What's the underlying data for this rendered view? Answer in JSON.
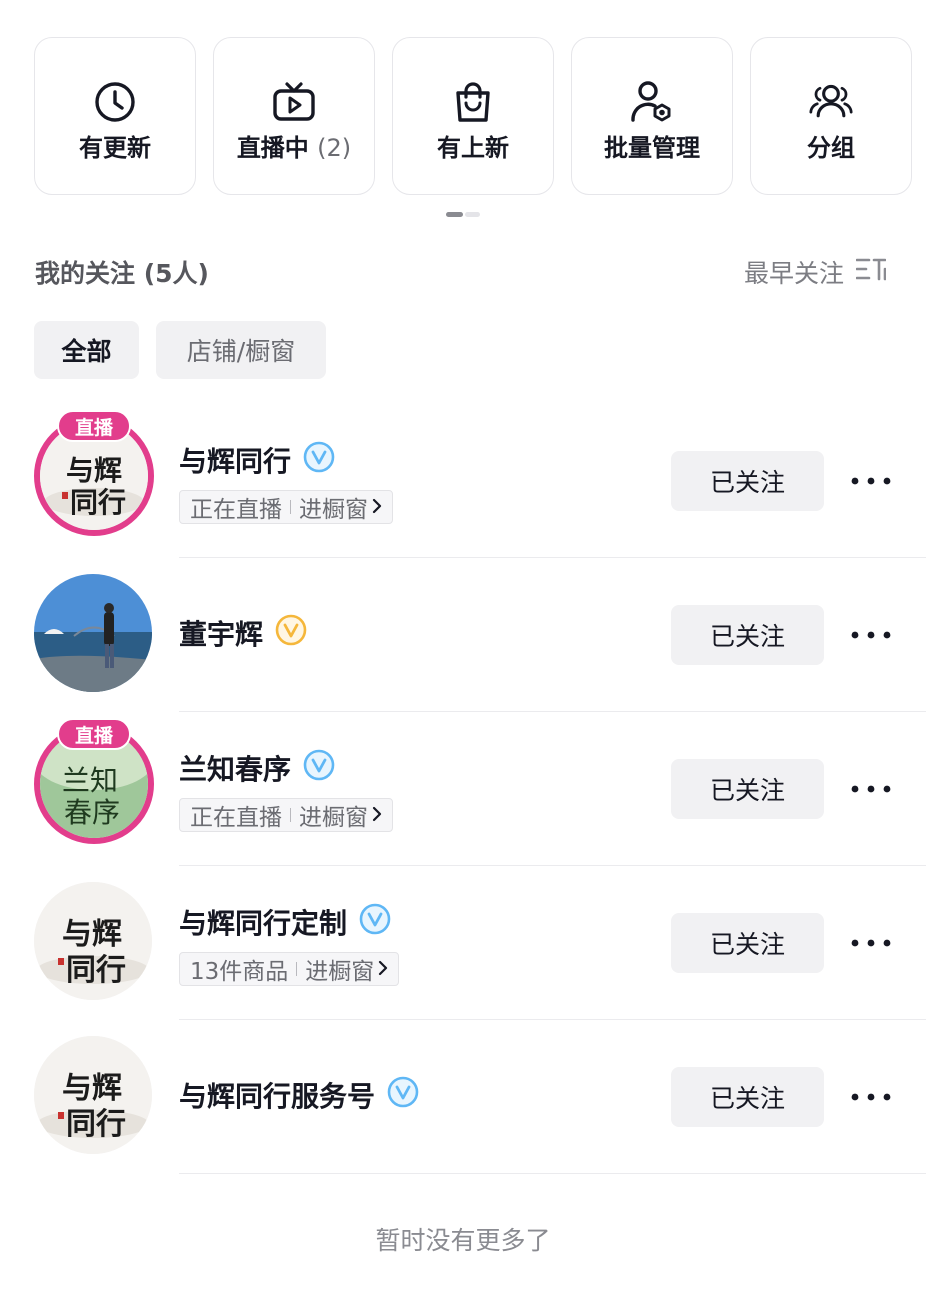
{
  "quick_actions": [
    {
      "label": "有更新",
      "count": "",
      "icon": "clock-icon"
    },
    {
      "label": "直播中",
      "count": "(2)",
      "icon": "tv-icon"
    },
    {
      "label": "有上新",
      "count": "",
      "icon": "shopping-bag-icon"
    },
    {
      "label": "批量管理",
      "count": "",
      "icon": "user-gear-icon"
    },
    {
      "label": "分组",
      "count": "",
      "icon": "group-icon"
    }
  ],
  "pager": {
    "pages": 2,
    "active": 1
  },
  "section": {
    "title": "我的关注 (5人)",
    "sort_label": "最早关注",
    "sort_icon": "sort-icon"
  },
  "filters": [
    {
      "label": "全部",
      "selected": true
    },
    {
      "label": "店铺/橱窗",
      "selected": false
    }
  ],
  "follows": [
    {
      "name": "与辉同行",
      "verified_color": "#5fb7f5",
      "live": true,
      "live_label": "直播",
      "status": "正在直播",
      "window_label": "进橱窗",
      "button": "已关注",
      "avatar_text_top": "与辉",
      "avatar_text_bottom": "同行"
    },
    {
      "name": "董宇辉",
      "verified_color": "#f5b73b",
      "live": false,
      "live_label": "",
      "status": "",
      "window_label": "",
      "button": "已关注",
      "avatar_text_top": "",
      "avatar_text_bottom": ""
    },
    {
      "name": "兰知春序",
      "verified_color": "#5fb7f5",
      "live": true,
      "live_label": "直播",
      "status": "正在直播",
      "window_label": "进橱窗",
      "button": "已关注",
      "avatar_text_top": "兰知",
      "avatar_text_bottom": "春序"
    },
    {
      "name": "与辉同行定制",
      "verified_color": "#5fb7f5",
      "live": false,
      "live_label": "",
      "status": "13件商品",
      "window_label": "进橱窗",
      "button": "已关注",
      "avatar_text_top": "与辉",
      "avatar_text_bottom": "同行"
    },
    {
      "name": "与辉同行服务号",
      "verified_color": "#5fb7f5",
      "live": false,
      "live_label": "",
      "status": "",
      "window_label": "",
      "button": "已关注",
      "avatar_text_top": "与辉",
      "avatar_text_bottom": "同行"
    }
  ],
  "footer": "暂时没有更多了"
}
